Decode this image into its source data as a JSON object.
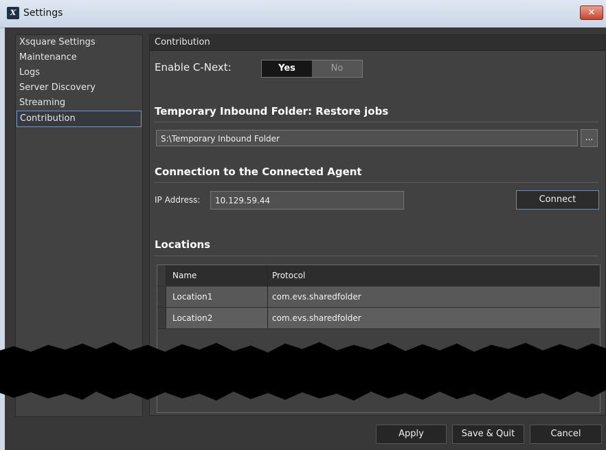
{
  "window": {
    "title": "Settings",
    "app_icon": "X"
  },
  "sidebar": {
    "items": [
      {
        "label": "Xsquare Settings"
      },
      {
        "label": "Maintenance"
      },
      {
        "label": "Logs"
      },
      {
        "label": "Server Discovery"
      },
      {
        "label": "Streaming"
      },
      {
        "label": "Contribution",
        "selected": true
      }
    ]
  },
  "panel": {
    "header": "Contribution",
    "enable_label": "Enable C-Next:",
    "toggle": {
      "yes": "Yes",
      "no": "No",
      "selected": "Yes"
    },
    "temp_folder_section": "Temporary Inbound Folder: Restore jobs",
    "temp_folder_value": "S:\\Temporary Inbound Folder",
    "browse_label": "...",
    "connection_section": "Connection to the Connected Agent",
    "ip_label": "IP Address:",
    "ip_value": "10.129.59.44",
    "connect_label": "Connect",
    "locations_section": "Locations",
    "table": {
      "columns": [
        "Name",
        "Protocol"
      ],
      "rows": [
        [
          "Location1",
          "com.evs.sharedfolder"
        ],
        [
          "Location2",
          "com.evs.sharedfolder"
        ]
      ]
    }
  },
  "footer": {
    "apply": "Apply",
    "save_quit": "Save & Quit",
    "cancel": "Cancel"
  },
  "colors": {
    "background": "#383838",
    "panel": "#414141",
    "accent_border": "#5e8fbf",
    "close_button": "#c9452c"
  }
}
